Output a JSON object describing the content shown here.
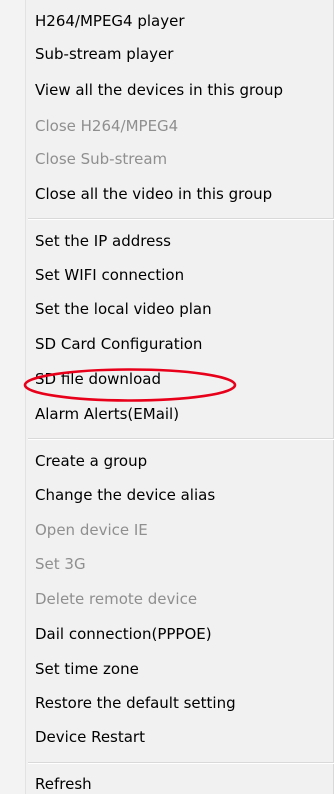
{
  "menu": {
    "items": [
      {
        "label": "H264/MPEG4 player",
        "enabled": true
      },
      {
        "label": "Sub-stream player",
        "enabled": true
      },
      {
        "label": "View all the devices in this group",
        "enabled": true
      },
      {
        "label": "Close H264/MPEG4",
        "enabled": false
      },
      {
        "label": "Close Sub-stream",
        "enabled": false
      },
      {
        "label": "Close all the video in this group",
        "enabled": true
      },
      {
        "label": "Set the IP address",
        "enabled": true
      },
      {
        "label": "Set WIFI connection",
        "enabled": true
      },
      {
        "label": "Set the local video plan",
        "enabled": true
      },
      {
        "label": "SD Card Configuration",
        "enabled": true
      },
      {
        "label": "SD file download",
        "enabled": true
      },
      {
        "label": "Alarm Alerts(EMail)",
        "enabled": true
      },
      {
        "label": "Create a group",
        "enabled": true
      },
      {
        "label": "Change the device alias",
        "enabled": true
      },
      {
        "label": "Open device IE",
        "enabled": false
      },
      {
        "label": "Set 3G",
        "enabled": false
      },
      {
        "label": "Delete remote device",
        "enabled": false
      },
      {
        "label": "Dail connection(PPPOE)",
        "enabled": true
      },
      {
        "label": "Set time zone",
        "enabled": true
      },
      {
        "label": "Restore the default setting",
        "enabled": true
      },
      {
        "label": "Device Restart",
        "enabled": true
      },
      {
        "label": "Refresh",
        "enabled": true
      }
    ]
  },
  "annotation": {
    "highlight_color": "#e8001a",
    "highlighted_item": "SD file download"
  },
  "colors": {
    "menu_background": "#f1f1f1",
    "disabled_text": "#8f8f8f",
    "enabled_text": "#000000"
  }
}
